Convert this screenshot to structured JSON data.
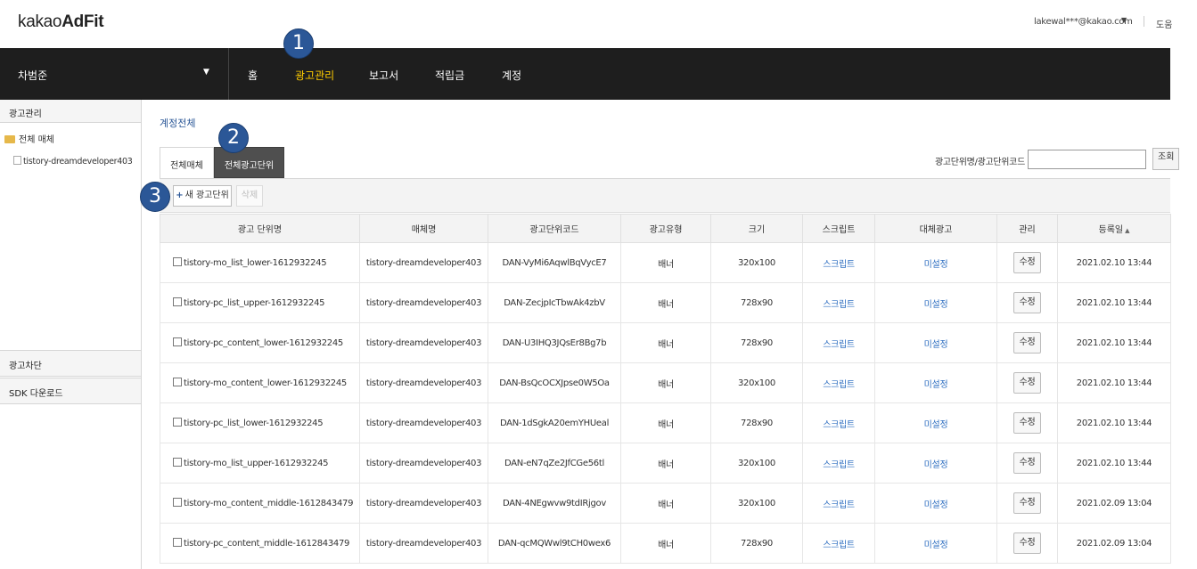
{
  "header": {
    "logo_light": "kakao",
    "logo_bold": "AdFit",
    "account_email": "lakewal***@kakao.com",
    "account_caret": "▼",
    "help_label": "도움"
  },
  "navbar": {
    "user_name": "차범준",
    "user_caret": "▼",
    "items": [
      {
        "label": "홈"
      },
      {
        "label": "광고관리"
      },
      {
        "label": "보고서"
      },
      {
        "label": "적립금"
      },
      {
        "label": "계정"
      }
    ]
  },
  "badges": [
    "1",
    "2",
    "3"
  ],
  "sidebar": {
    "section1": "광고관리",
    "tree_root": "전체 매체",
    "tree_child": "tistory-dreamdeveloper403",
    "section2": "광고차단",
    "section3": "SDK 다운로드"
  },
  "main": {
    "title": "계정전체",
    "tabs": [
      {
        "label": "전체매체"
      },
      {
        "label": "전체광고단위"
      }
    ],
    "search": {
      "label": "광고단위명/광고단위코드",
      "value": "",
      "button_label": "조회"
    },
    "toolbar": {
      "new_button_icon": "+",
      "new_button_label": "새 광고단위",
      "delete_button_label": "삭제"
    },
    "table": {
      "headers": [
        "광고 단위명",
        "매체명",
        "광고단위코드",
        "광고유형",
        "크기",
        "스크립트",
        "대체광고",
        "관리",
        "등록일"
      ],
      "sort_indicator": "▲",
      "rows": [
        {
          "name": "tistory-mo_list_lower-1612932245",
          "media": "tistory-dreamdeveloper403",
          "code": "DAN-VyMi6AqwlBqVycE7",
          "type": "배너",
          "size": "320x100",
          "script": "스크립트",
          "alt": "미설정",
          "manage": "수정",
          "date": "2021.02.10 13:44"
        },
        {
          "name": "tistory-pc_list_upper-1612932245",
          "media": "tistory-dreamdeveloper403",
          "code": "DAN-ZecjpIcTbwAk4zbV",
          "type": "배너",
          "size": "728x90",
          "script": "스크립트",
          "alt": "미설정",
          "manage": "수정",
          "date": "2021.02.10 13:44"
        },
        {
          "name": "tistory-pc_content_lower-1612932245",
          "media": "tistory-dreamdeveloper403",
          "code": "DAN-U3IHQ3JQsEr8Bg7b",
          "type": "배너",
          "size": "728x90",
          "script": "스크립트",
          "alt": "미설정",
          "manage": "수정",
          "date": "2021.02.10 13:44"
        },
        {
          "name": "tistory-mo_content_lower-1612932245",
          "media": "tistory-dreamdeveloper403",
          "code": "DAN-BsQcOCXJpse0W5Oa",
          "type": "배너",
          "size": "320x100",
          "script": "스크립트",
          "alt": "미설정",
          "manage": "수정",
          "date": "2021.02.10 13:44"
        },
        {
          "name": "tistory-pc_list_lower-1612932245",
          "media": "tistory-dreamdeveloper403",
          "code": "DAN-1dSgkA20emYHUeal",
          "type": "배너",
          "size": "728x90",
          "script": "스크립트",
          "alt": "미설정",
          "manage": "수정",
          "date": "2021.02.10 13:44"
        },
        {
          "name": "tistory-mo_list_upper-1612932245",
          "media": "tistory-dreamdeveloper403",
          "code": "DAN-eN7qZe2JfCGe56tl",
          "type": "배너",
          "size": "320x100",
          "script": "스크립트",
          "alt": "미설정",
          "manage": "수정",
          "date": "2021.02.10 13:44"
        },
        {
          "name": "tistory-mo_content_middle-1612843479",
          "media": "tistory-dreamdeveloper403",
          "code": "DAN-4NEgwvw9tdIRjgov",
          "type": "배너",
          "size": "320x100",
          "script": "스크립트",
          "alt": "미설정",
          "manage": "수정",
          "date": "2021.02.09 13:04"
        },
        {
          "name": "tistory-pc_content_middle-1612843479",
          "media": "tistory-dreamdeveloper403",
          "code": "DAN-qcMQWwl9tCH0wex6",
          "type": "배너",
          "size": "728x90",
          "script": "스크립트",
          "alt": "미설정",
          "manage": "수정",
          "date": "2021.02.09 13:04"
        }
      ]
    }
  }
}
